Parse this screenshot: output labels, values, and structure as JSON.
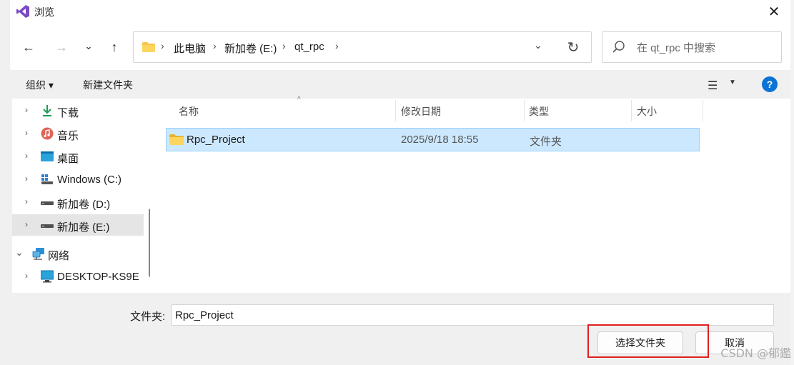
{
  "window": {
    "title": "浏览",
    "close_glyph": "✕"
  },
  "navigation": {
    "back_glyph": "←",
    "forward_glyph": "→",
    "recent_glyph": "⌄",
    "up_glyph": "↑"
  },
  "address_bar": {
    "crumbs": [
      "此电脑",
      "新加卷 (E:)",
      "qt_rpc"
    ],
    "separator": "›",
    "dropdown_glyph": "⌄",
    "refresh_glyph": "↻"
  },
  "search": {
    "placeholder": "在 qt_rpc 中搜索"
  },
  "toolbar": {
    "organize_label": "组织 ▾",
    "new_folder_label": "新建文件夹",
    "view_glyph": "☰",
    "view_dropdown_glyph": "▼",
    "help_glyph": "?"
  },
  "sidebar": {
    "items": [
      {
        "label": "下载",
        "icon": "download-icon",
        "chevron": "›"
      },
      {
        "label": "音乐",
        "icon": "music-icon",
        "chevron": "›"
      },
      {
        "label": "桌面",
        "icon": "desktop-icon",
        "chevron": "›"
      },
      {
        "label": "Windows (C:)",
        "icon": "windows-drive-icon",
        "chevron": "›"
      },
      {
        "label": "新加卷 (D:)",
        "icon": "drive-icon",
        "chevron": "›"
      },
      {
        "label": "新加卷 (E:)",
        "icon": "drive-icon",
        "chevron": "›",
        "selected": true
      },
      {
        "label": "网络",
        "icon": "network-icon",
        "chevron": "⌄"
      },
      {
        "label": "DESKTOP-KS9E",
        "icon": "computer-icon",
        "chevron": "›"
      }
    ]
  },
  "file_list": {
    "columns": [
      "名称",
      "修改日期",
      "类型",
      "大小"
    ],
    "sort_glyph": "^",
    "rows": [
      {
        "name": "Rpc_Project",
        "modified": "2025/9/18 18:55",
        "type": "文件夹",
        "size": ""
      }
    ]
  },
  "footer": {
    "folder_label": "文件夹:",
    "folder_value": "Rpc_Project",
    "select_button": "选择文件夹",
    "cancel_button": "取消"
  },
  "watermark": "CSDN @郁鑑",
  "colors": {
    "accent": "#0a74d6",
    "selection_bg": "#cce8ff",
    "selection_border": "#99d1ff",
    "highlight_box": "#e02020"
  }
}
